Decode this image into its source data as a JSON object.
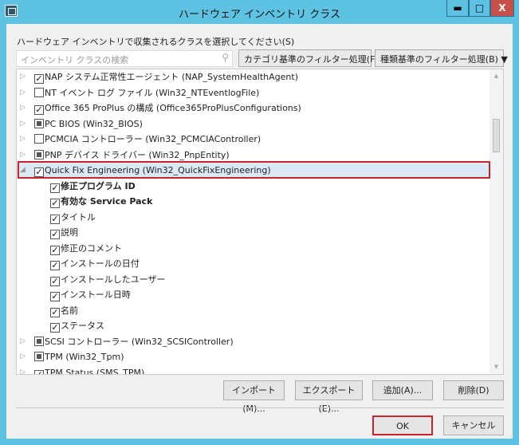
{
  "window": {
    "title": "ハードウェア インベントリ クラス",
    "min": "▬",
    "max": "□",
    "close": "X"
  },
  "prompt": "ハードウェア インベントリで収集されるクラスを選択してください(S)",
  "search": {
    "placeholder": "インベントリ クラスの検索",
    "icon": "search-icon"
  },
  "filters": {
    "category": "カテゴリ基準のフィルター処理(F) ▼",
    "type": "種類基準のフィルター処理(B) ▼"
  },
  "rows": [
    {
      "label": "NAP システム正常性エージェント (NAP_SystemHealthAgent)",
      "state": "checked",
      "level": 0,
      "expand": "▷"
    },
    {
      "label": "NT イベント ログ ファイル (Win32_NTEventlogFile)",
      "state": "unchecked",
      "level": 0,
      "expand": "▷"
    },
    {
      "label": "Office 365 ProPlus の構成 (Office365ProPlusConfigurations)",
      "state": "checked",
      "level": 0,
      "expand": "▷"
    },
    {
      "label": "PC BIOS (Win32_BIOS)",
      "state": "partial",
      "level": 0,
      "expand": "▷"
    },
    {
      "label": "PCMCIA コントローラー (Win32_PCMCIAController)",
      "state": "unchecked",
      "level": 0,
      "expand": "▷"
    },
    {
      "label": "PNP デバイス ドライバー (Win32_PnpEntity)",
      "state": "partial",
      "level": 0,
      "expand": "▷"
    },
    {
      "label": "Quick Fix Engineering (Win32_QuickFixEngineering)",
      "state": "checked",
      "level": 0,
      "expand": "◢",
      "selected": true
    },
    {
      "label": "修正プログラム ID",
      "state": "checked",
      "level": 1,
      "bold": true
    },
    {
      "label": "有効な Service Pack",
      "state": "checked",
      "level": 1,
      "bold": true
    },
    {
      "label": "タイトル",
      "state": "checked",
      "level": 1
    },
    {
      "label": "説明",
      "state": "checked",
      "level": 1
    },
    {
      "label": "修正のコメント",
      "state": "checked",
      "level": 1
    },
    {
      "label": "インストールの日付",
      "state": "checked",
      "level": 1
    },
    {
      "label": "インストールしたユーザー",
      "state": "checked",
      "level": 1
    },
    {
      "label": "インストール日時",
      "state": "checked",
      "level": 1
    },
    {
      "label": "名前",
      "state": "checked",
      "level": 1
    },
    {
      "label": "ステータス",
      "state": "checked",
      "level": 1
    },
    {
      "label": "SCSI コントローラー (Win32_SCSIController)",
      "state": "partial",
      "level": 0,
      "expand": "▷"
    },
    {
      "label": "TPM (Win32_Tpm)",
      "state": "partial",
      "level": 0,
      "expand": "▷"
    },
    {
      "label": "TPM Status (SMS_TPM)",
      "state": "checked",
      "level": 0,
      "expand": "▷"
    }
  ],
  "buttons": {
    "import": "インポート(M)...",
    "export": "エクスポート(E)...",
    "add": "追加(A)...",
    "delete": "削除(D)",
    "ok": "OK",
    "cancel": "キャンセル"
  },
  "colors": {
    "frame": "#5ec3e2",
    "highlight": "#c8242c"
  }
}
